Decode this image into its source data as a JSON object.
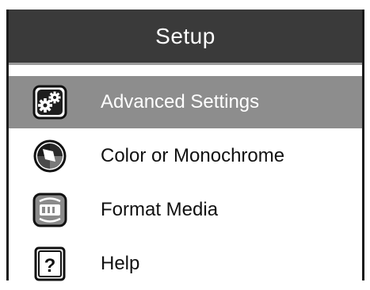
{
  "header": {
    "title": "Setup"
  },
  "menu": {
    "items": [
      {
        "label": "Advanced Settings",
        "icon": "gears-icon",
        "selected": true
      },
      {
        "label": "Color or Monochrome",
        "icon": "color-mode-icon",
        "selected": false
      },
      {
        "label": "Format Media",
        "icon": "format-media-icon",
        "selected": false
      },
      {
        "label": "Help",
        "icon": "help-icon",
        "selected": false
      }
    ]
  },
  "colors": {
    "header_bg": "#3a3a3a",
    "selected_bg": "#8d8d8d",
    "text": "#111111"
  }
}
